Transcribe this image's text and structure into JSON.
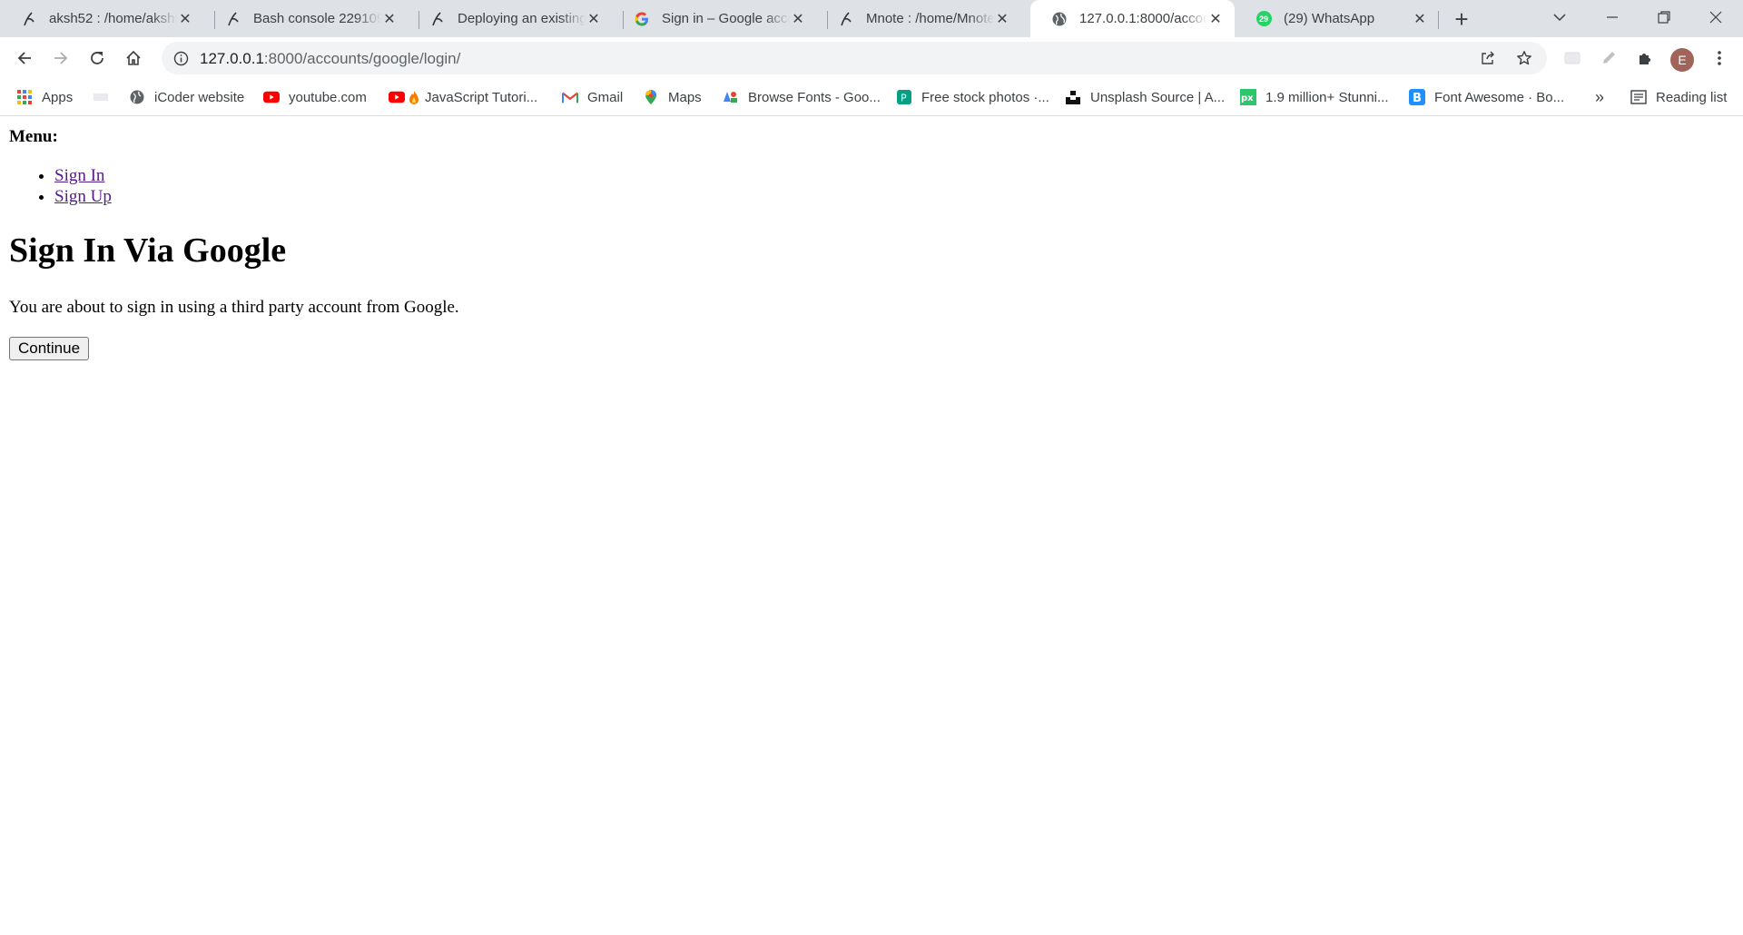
{
  "tabs": [
    {
      "label": "aksh52 : /home/aksh52",
      "icon": "pythonanywhere-icon",
      "active": false
    },
    {
      "label": "Bash console 22910938",
      "icon": "pythonanywhere-icon",
      "active": false
    },
    {
      "label": "Deploying an existing",
      "icon": "pythonanywhere-icon",
      "active": false
    },
    {
      "label": "Sign in – Google accounts",
      "icon": "google-icon",
      "active": false
    },
    {
      "label": "Mnote : /home/Mnote",
      "icon": "pythonanywhere-icon",
      "active": false
    },
    {
      "label": "127.0.0.1:8000/accounts",
      "icon": "globe-icon",
      "active": true
    },
    {
      "label": "(29) WhatsApp",
      "icon": "whatsapp-icon",
      "active": false
    }
  ],
  "address": {
    "host": "127.0.0.1",
    "path": ":8000/accounts/google/login/"
  },
  "whatsapp_badge": "29",
  "profile_initial": "E",
  "bookmarks": [
    {
      "label": "Apps"
    },
    {
      "label": ""
    },
    {
      "label": "iCoder website"
    },
    {
      "label": "youtube.com"
    },
    {
      "label": "JavaScript Tutori..."
    },
    {
      "label": "Gmail"
    },
    {
      "label": "Maps"
    },
    {
      "label": "Browse Fonts - Goo..."
    },
    {
      "label": "Free stock photos ·..."
    },
    {
      "label": "Unsplash Source | A..."
    },
    {
      "label": "1.9 million+ Stunni..."
    },
    {
      "label": "Font Awesome · Bo..."
    }
  ],
  "bookmarks_overflow": "»",
  "reading_list": "Reading list",
  "page": {
    "menu_label": "Menu:",
    "menu_items": [
      "Sign In",
      "Sign Up"
    ],
    "heading": "Sign In Via Google",
    "description": "You are about to sign in using a third party account from Google.",
    "continue_label": "Continue"
  }
}
